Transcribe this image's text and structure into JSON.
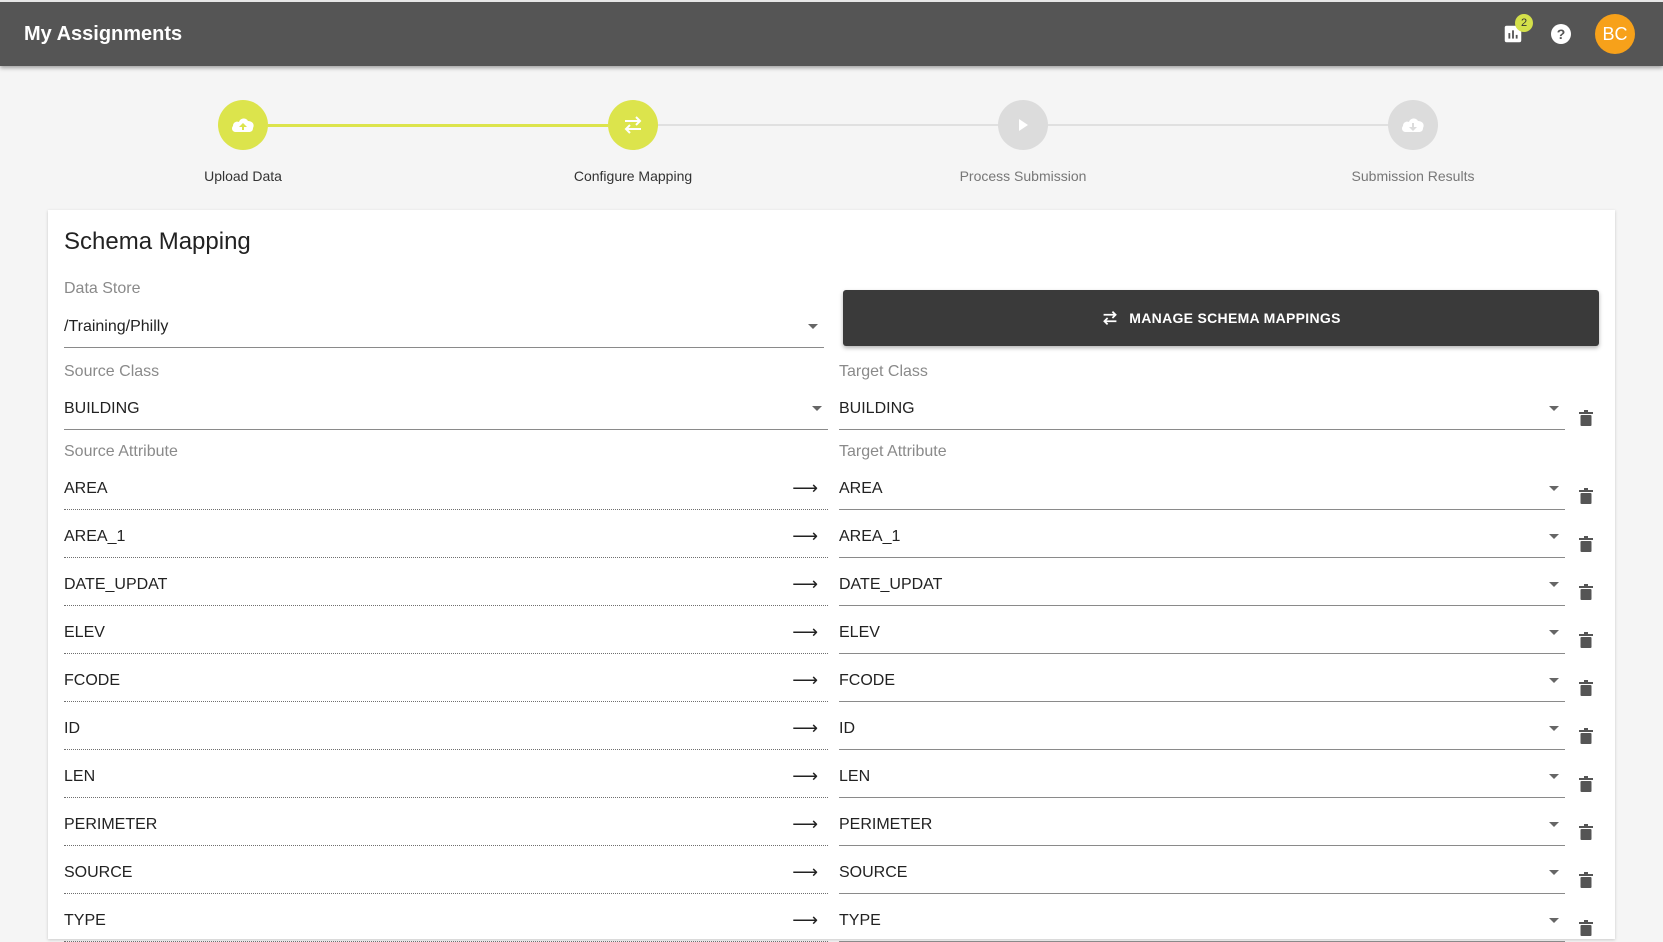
{
  "header": {
    "title": "My Assignments",
    "notifications_count": "2",
    "avatar_initials": "BC",
    "icons": [
      "report-icon",
      "help-icon"
    ]
  },
  "stepper": {
    "steps": [
      {
        "label": "Upload Data",
        "state": "complete",
        "icon": "cloud-upload-icon"
      },
      {
        "label": "Configure Mapping",
        "state": "active",
        "icon": "swap-icon"
      },
      {
        "label": "Process Submission",
        "state": "pending",
        "icon": "play-icon"
      },
      {
        "label": "Submission Results",
        "state": "pending",
        "icon": "cloud-download-icon"
      }
    ]
  },
  "schema": {
    "title": "Schema Mapping",
    "data_store_label": "Data Store",
    "data_store_value": "/Training/Philly",
    "manage_button": "MANAGE SCHEMA MAPPINGS",
    "source_class_label": "Source Class",
    "source_class_value": "BUILDING",
    "target_class_label": "Target Class",
    "target_class_value": "BUILDING",
    "source_attribute_label": "Source Attribute",
    "target_attribute_label": "Target Attribute",
    "rows": [
      {
        "source": "AREA",
        "target": "AREA"
      },
      {
        "source": "AREA_1",
        "target": "AREA_1"
      },
      {
        "source": "DATE_UPDAT",
        "target": "DATE_UPDAT"
      },
      {
        "source": "ELEV",
        "target": "ELEV"
      },
      {
        "source": "FCODE",
        "target": "FCODE"
      },
      {
        "source": "ID",
        "target": "ID"
      },
      {
        "source": "LEN",
        "target": "LEN"
      },
      {
        "source": "PERIMETER",
        "target": "PERIMETER"
      },
      {
        "source": "SOURCE",
        "target": "SOURCE"
      },
      {
        "source": "TYPE",
        "target": "TYPE"
      }
    ]
  },
  "colors": {
    "header_bg": "#555555",
    "accent": "#dce44c",
    "avatar": "#f7a11a",
    "button_dark": "#3a3a3a"
  }
}
